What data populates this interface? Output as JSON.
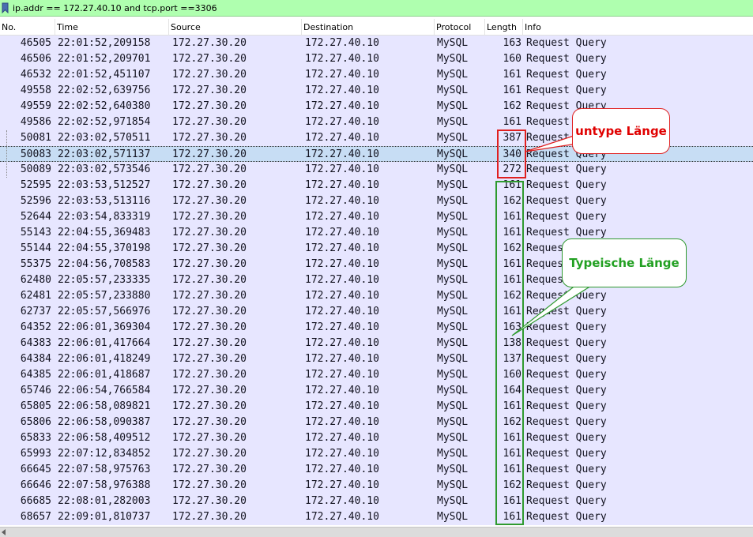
{
  "filter": {
    "expression": "ip.addr == 172.27.40.10 and tcp.port ==3306"
  },
  "columns": [
    "No.",
    "Time",
    "Source",
    "Destination",
    "Protocol",
    "Length",
    "Info"
  ],
  "packets": [
    [
      "46505",
      "22:01:52,209158",
      "172.27.30.20",
      "172.27.40.10",
      "MySQL",
      "163",
      "Request Query"
    ],
    [
      "46506",
      "22:01:52,209701",
      "172.27.30.20",
      "172.27.40.10",
      "MySQL",
      "160",
      "Request Query"
    ],
    [
      "46532",
      "22:01:52,451107",
      "172.27.30.20",
      "172.27.40.10",
      "MySQL",
      "161",
      "Request Query"
    ],
    [
      "49558",
      "22:02:52,639756",
      "172.27.30.20",
      "172.27.40.10",
      "MySQL",
      "161",
      "Request Query"
    ],
    [
      "49559",
      "22:02:52,640380",
      "172.27.30.20",
      "172.27.40.10",
      "MySQL",
      "162",
      "Request Query"
    ],
    [
      "49586",
      "22:02:52,971854",
      "172.27.30.20",
      "172.27.40.10",
      "MySQL",
      "161",
      "Request Query"
    ],
    [
      "50081",
      "22:03:02,570511",
      "172.27.30.20",
      "172.27.40.10",
      "MySQL",
      "387",
      "Request Query"
    ],
    [
      "50083",
      "22:03:02,571137",
      "172.27.30.20",
      "172.27.40.10",
      "MySQL",
      "340",
      "Request Query"
    ],
    [
      "50089",
      "22:03:02,573546",
      "172.27.30.20",
      "172.27.40.10",
      "MySQL",
      "272",
      "Request Query"
    ],
    [
      "52595",
      "22:03:53,512527",
      "172.27.30.20",
      "172.27.40.10",
      "MySQL",
      "161",
      "Request Query"
    ],
    [
      "52596",
      "22:03:53,513116",
      "172.27.30.20",
      "172.27.40.10",
      "MySQL",
      "162",
      "Request Query"
    ],
    [
      "52644",
      "22:03:54,833319",
      "172.27.30.20",
      "172.27.40.10",
      "MySQL",
      "161",
      "Request Query"
    ],
    [
      "55143",
      "22:04:55,369483",
      "172.27.30.20",
      "172.27.40.10",
      "MySQL",
      "161",
      "Request Query"
    ],
    [
      "55144",
      "22:04:55,370198",
      "172.27.30.20",
      "172.27.40.10",
      "MySQL",
      "162",
      "Request Query"
    ],
    [
      "55375",
      "22:04:56,708583",
      "172.27.30.20",
      "172.27.40.10",
      "MySQL",
      "161",
      "Request Query"
    ],
    [
      "62480",
      "22:05:57,233335",
      "172.27.30.20",
      "172.27.40.10",
      "MySQL",
      "161",
      "Request Query"
    ],
    [
      "62481",
      "22:05:57,233880",
      "172.27.30.20",
      "172.27.40.10",
      "MySQL",
      "162",
      "Request Query"
    ],
    [
      "62737",
      "22:05:57,566976",
      "172.27.30.20",
      "172.27.40.10",
      "MySQL",
      "161",
      "Request Query"
    ],
    [
      "64352",
      "22:06:01,369304",
      "172.27.30.20",
      "172.27.40.10",
      "MySQL",
      "163",
      "Request Query"
    ],
    [
      "64383",
      "22:06:01,417664",
      "172.27.30.20",
      "172.27.40.10",
      "MySQL",
      "138",
      "Request Query"
    ],
    [
      "64384",
      "22:06:01,418249",
      "172.27.30.20",
      "172.27.40.10",
      "MySQL",
      "137",
      "Request Query"
    ],
    [
      "64385",
      "22:06:01,418687",
      "172.27.30.20",
      "172.27.40.10",
      "MySQL",
      "160",
      "Request Query"
    ],
    [
      "65746",
      "22:06:54,766584",
      "172.27.30.20",
      "172.27.40.10",
      "MySQL",
      "164",
      "Request Query"
    ],
    [
      "65805",
      "22:06:58,089821",
      "172.27.30.20",
      "172.27.40.10",
      "MySQL",
      "161",
      "Request Query"
    ],
    [
      "65806",
      "22:06:58,090387",
      "172.27.30.20",
      "172.27.40.10",
      "MySQL",
      "162",
      "Request Query"
    ],
    [
      "65833",
      "22:06:58,409512",
      "172.27.30.20",
      "172.27.40.10",
      "MySQL",
      "161",
      "Request Query"
    ],
    [
      "65993",
      "22:07:12,834852",
      "172.27.30.20",
      "172.27.40.10",
      "MySQL",
      "161",
      "Request Query"
    ],
    [
      "66645",
      "22:07:58,975763",
      "172.27.30.20",
      "172.27.40.10",
      "MySQL",
      "161",
      "Request Query"
    ],
    [
      "66646",
      "22:07:58,976388",
      "172.27.30.20",
      "172.27.40.10",
      "MySQL",
      "162",
      "Request Query"
    ],
    [
      "66685",
      "22:08:01,282003",
      "172.27.30.20",
      "172.27.40.10",
      "MySQL",
      "161",
      "Request Query"
    ],
    [
      "68657",
      "22:09:01,810737",
      "172.27.30.20",
      "172.27.40.10",
      "MySQL",
      "161",
      "Request Query"
    ]
  ],
  "selected_packet": "50083",
  "annotations": {
    "atypical_label": "untype Länge",
    "typical_label": "Typeische Länge"
  },
  "colors": {
    "filter_bg": "#afffaf",
    "row_bg": "#e7e6ff",
    "selected_bg": "#c7ddf4",
    "atypical": "#e02020",
    "typical": "#2f9a2f"
  },
  "icons": {
    "filter_bookmark": "bookmark-icon",
    "scroll_left": "scroll-left-arrow-icon"
  }
}
